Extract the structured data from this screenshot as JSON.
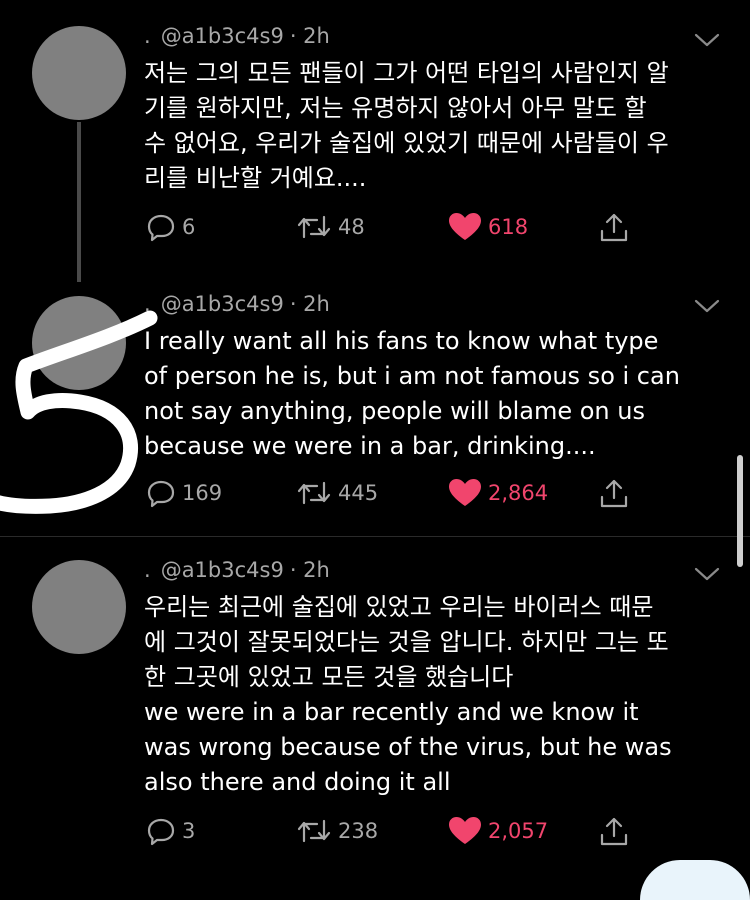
{
  "colors": {
    "like": "#f1456d",
    "secondary": "#a8a8a8",
    "avatar": "#808080"
  },
  "tweets": [
    {
      "bullet": ".",
      "handle": "@a1b3c4s9",
      "time": "· 2h",
      "lines": [
        "저는 그의 모든 팬들이 그가 어떤 타입의 사람인지 알",
        "기를 원하지만, 저는 유명하지 않아서 아무 말도 할",
        "수 없어요, 우리가 술집에 있었기 때문에 사람들이 우",
        "리를 비난할 거예요...."
      ],
      "replies": "6",
      "retweets": "48",
      "likes": "618"
    },
    {
      "bullet": ".",
      "handle": "@a1b3c4s9",
      "time": "· 2h",
      "lines": [
        "I really want all his fans to know what type",
        "of person he is, but i am not famous so i can",
        "not say anything, people will blame on us",
        "because we were in a bar, drinking...."
      ],
      "replies": "169",
      "retweets": "445",
      "likes": "2,864"
    },
    {
      "bullet": ".",
      "handle": "@a1b3c4s9",
      "time": "· 2h",
      "lines": [
        "우리는 최근에 술집에 있었고 우리는 바이러스 때문",
        "에 그것이 잘못되었다는 것을 압니다. 하지만 그는 또",
        "한 그곳에 있었고 모든 것을 했습니다",
        "we were in a bar recently and we know it",
        "was wrong because of the virus, but he was",
        "also there and doing it all"
      ],
      "replies": "3",
      "retweets": "238",
      "likes": "2,057"
    }
  ],
  "annotation": {
    "number": "5"
  }
}
